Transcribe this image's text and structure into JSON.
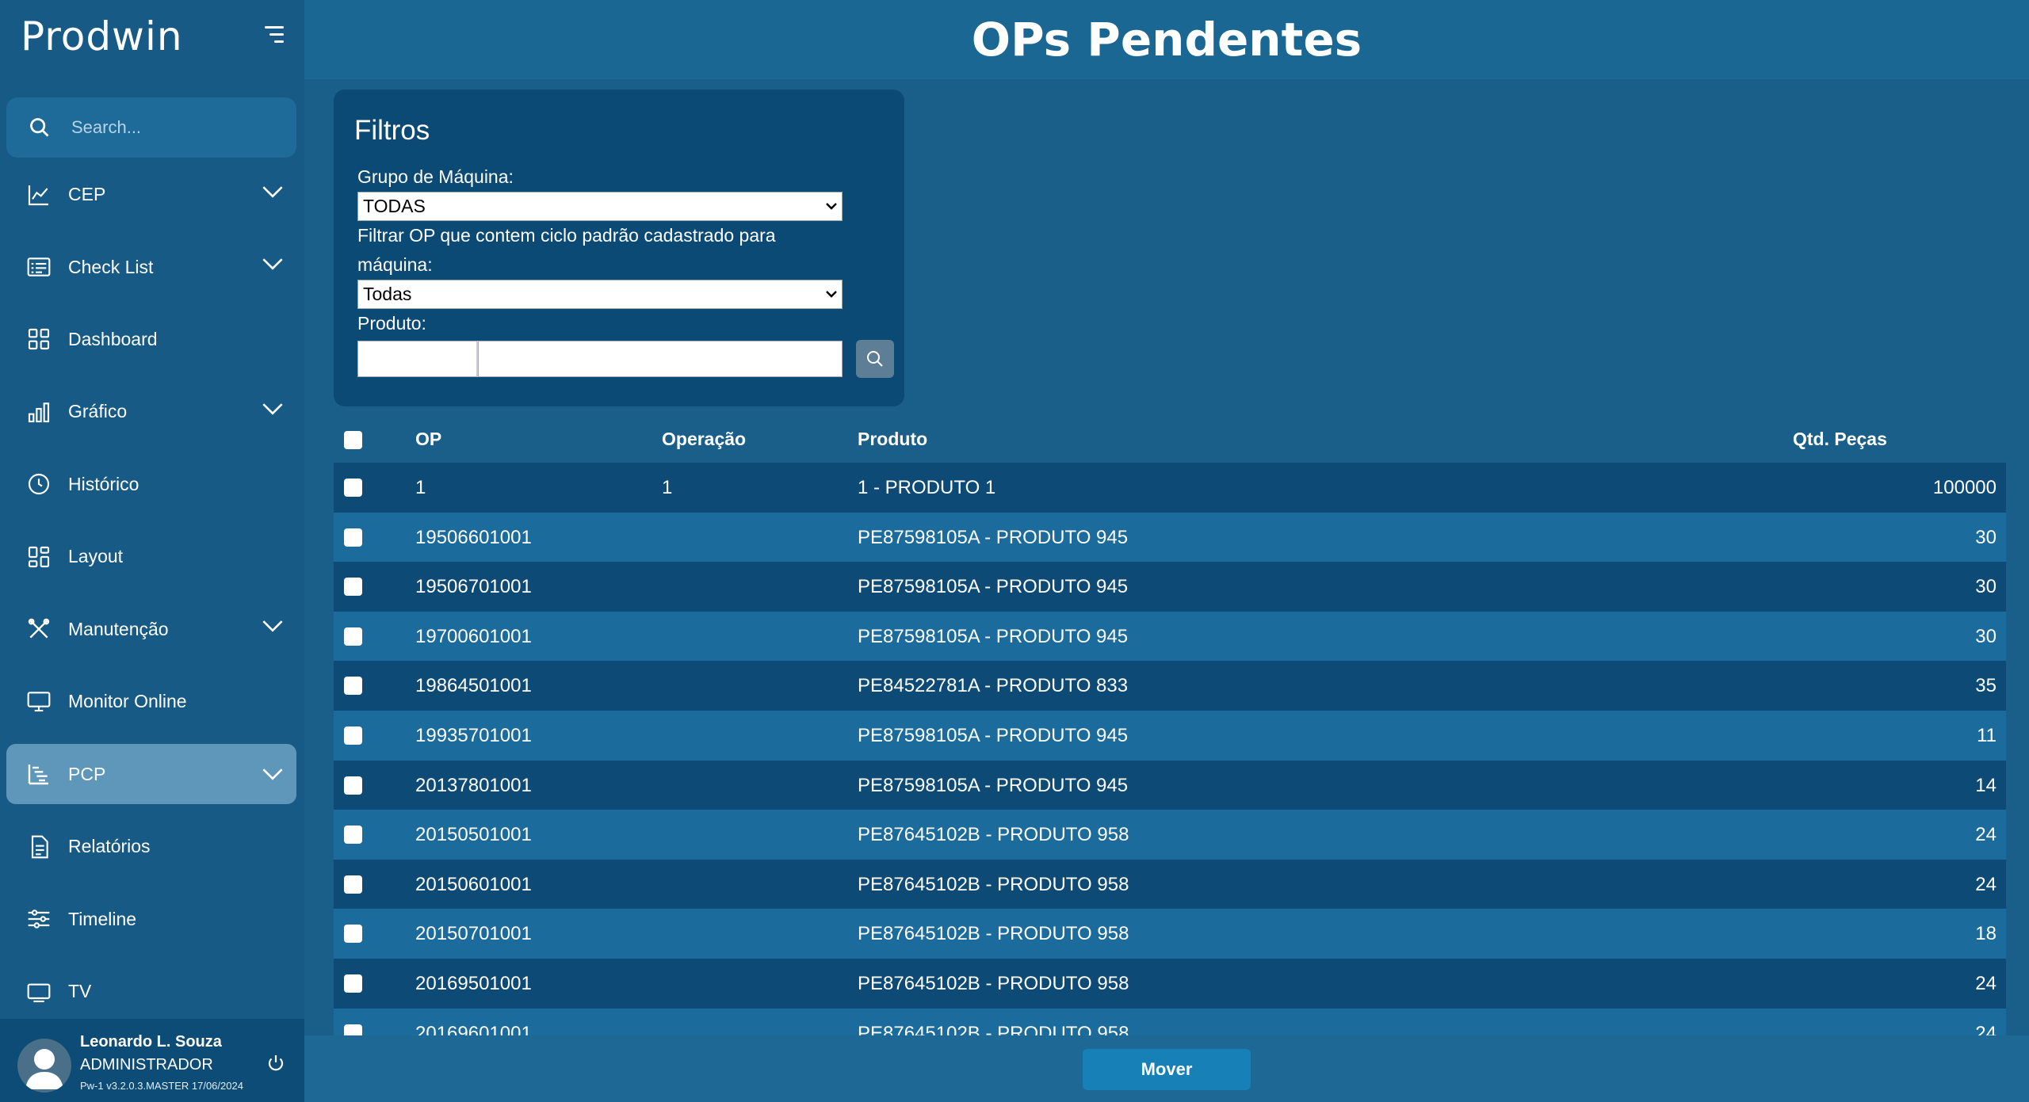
{
  "app": {
    "logo": "Prodwin",
    "page_title": "OPs Pendentes"
  },
  "sidebar": {
    "search_placeholder": "Search...",
    "items": [
      {
        "label": "CEP",
        "icon": "line-chart-icon",
        "expandable": true
      },
      {
        "label": "Check List",
        "icon": "checklist-icon",
        "expandable": true
      },
      {
        "label": "Dashboard",
        "icon": "dashboard-grid-icon",
        "expandable": false
      },
      {
        "label": "Gráfico",
        "icon": "bar-chart-icon",
        "expandable": true
      },
      {
        "label": "Histórico",
        "icon": "clock-icon",
        "expandable": false
      },
      {
        "label": "Layout",
        "icon": "layout-icon",
        "expandable": false
      },
      {
        "label": "Manutenção",
        "icon": "tools-icon",
        "expandable": true
      },
      {
        "label": "Monitor Online",
        "icon": "monitor-icon",
        "expandable": false
      },
      {
        "label": "PCP",
        "icon": "pcp-list-icon",
        "expandable": true,
        "active": true
      },
      {
        "label": "Relatórios",
        "icon": "report-icon",
        "expandable": false
      },
      {
        "label": "Timeline",
        "icon": "sliders-icon",
        "expandable": false
      },
      {
        "label": "TV",
        "icon": "tv-icon",
        "expandable": false
      }
    ],
    "user": {
      "name": "Leonardo L. Souza",
      "role": "ADMINISTRADOR",
      "version": "Pw-1 v3.2.0.3.MASTER 17/06/2024"
    }
  },
  "filters": {
    "title": "Filtros",
    "machine_group_label": "Grupo de Máquina:",
    "machine_group_value": "TODAS",
    "cycle_filter_label": "Filtrar OP que contem ciclo padrão cadastrado para máquina:",
    "cycle_filter_value": "Todas",
    "product_label": "Produto:",
    "product_code": "",
    "product_desc": ""
  },
  "table": {
    "headers": {
      "op": "OP",
      "operacao": "Operação",
      "produto": "Produto",
      "qtd": "Qtd. Peças"
    },
    "rows": [
      {
        "op": "1",
        "operacao": "1",
        "produto": "1 - PRODUTO 1",
        "qtd": "100000"
      },
      {
        "op": "19506601001",
        "operacao": "",
        "produto": "PE87598105A - PRODUTO 945",
        "qtd": "30"
      },
      {
        "op": "19506701001",
        "operacao": "",
        "produto": "PE87598105A - PRODUTO 945",
        "qtd": "30"
      },
      {
        "op": "19700601001",
        "operacao": "",
        "produto": "PE87598105A - PRODUTO 945",
        "qtd": "30"
      },
      {
        "op": "19864501001",
        "operacao": "",
        "produto": "PE84522781A - PRODUTO 833",
        "qtd": "35"
      },
      {
        "op": "19935701001",
        "operacao": "",
        "produto": "PE87598105A - PRODUTO 945",
        "qtd": "11"
      },
      {
        "op": "20137801001",
        "operacao": "",
        "produto": "PE87598105A - PRODUTO 945",
        "qtd": "14"
      },
      {
        "op": "20150501001",
        "operacao": "",
        "produto": "PE87645102B - PRODUTO 958",
        "qtd": "24"
      },
      {
        "op": "20150601001",
        "operacao": "",
        "produto": "PE87645102B - PRODUTO 958",
        "qtd": "24"
      },
      {
        "op": "20150701001",
        "operacao": "",
        "produto": "PE87645102B - PRODUTO 958",
        "qtd": "18"
      },
      {
        "op": "20169501001",
        "operacao": "",
        "produto": "PE87645102B - PRODUTO 958",
        "qtd": "24"
      },
      {
        "op": "20169601001",
        "operacao": "",
        "produto": "PE87645102B - PRODUTO 958",
        "qtd": "24"
      }
    ]
  },
  "footer": {
    "move_label": "Mover"
  },
  "colors": {
    "sidebar": "#175a85",
    "active_nav": "#5f97bb",
    "panel": "#0b4a74",
    "row_dark": "#0d4a75",
    "row_light": "#1b6b9c",
    "button": "#1780b7"
  }
}
